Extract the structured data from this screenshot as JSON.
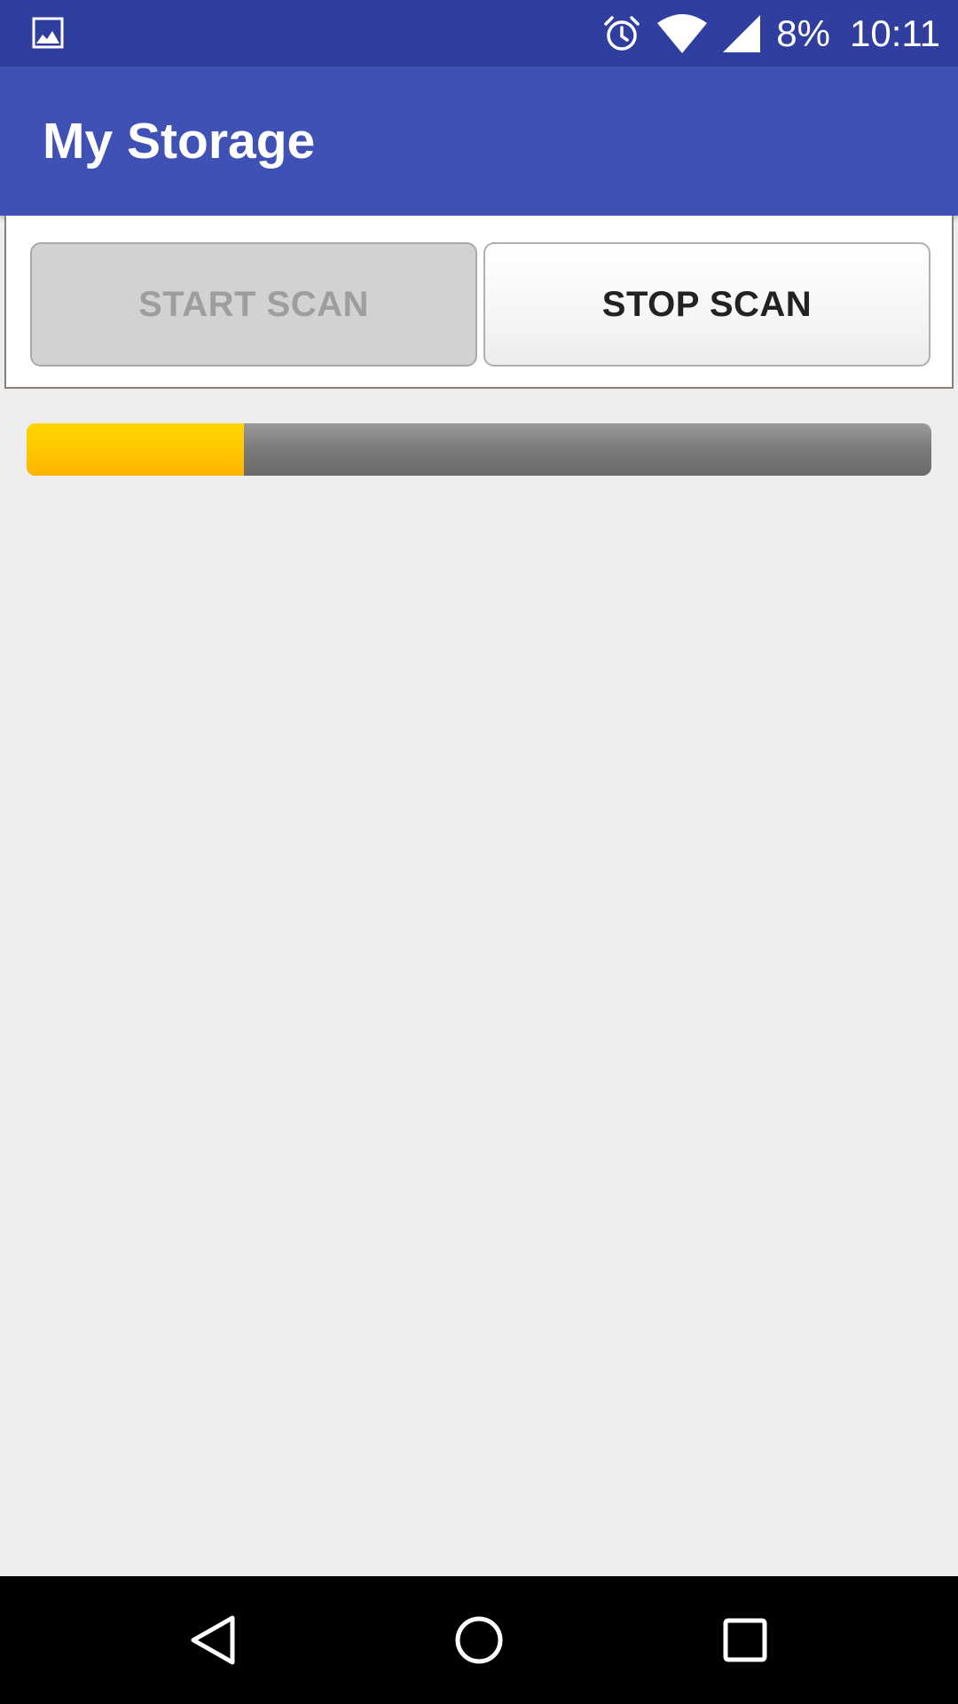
{
  "status_bar": {
    "notification_icon": "gallery-icon",
    "alarm_icon": "alarm-icon",
    "wifi_icon": "wifi-icon",
    "signal_icon": "cell-signal-icon",
    "battery_text": "8%",
    "clock": "10:11",
    "background_color": "#303f9f"
  },
  "app_bar": {
    "title": "My Storage",
    "background_color": "#3f51b5"
  },
  "buttons": {
    "start_label": "START SCAN",
    "start_enabled": false,
    "stop_label": "STOP SCAN",
    "stop_enabled": true
  },
  "progress": {
    "value_fraction": 0.24,
    "fill_color": "#ffc107",
    "track_color": "#777777"
  },
  "nav_bar": {
    "back_icon": "back-triangle-icon",
    "home_icon": "home-circle-icon",
    "recents_icon": "recents-square-icon"
  }
}
